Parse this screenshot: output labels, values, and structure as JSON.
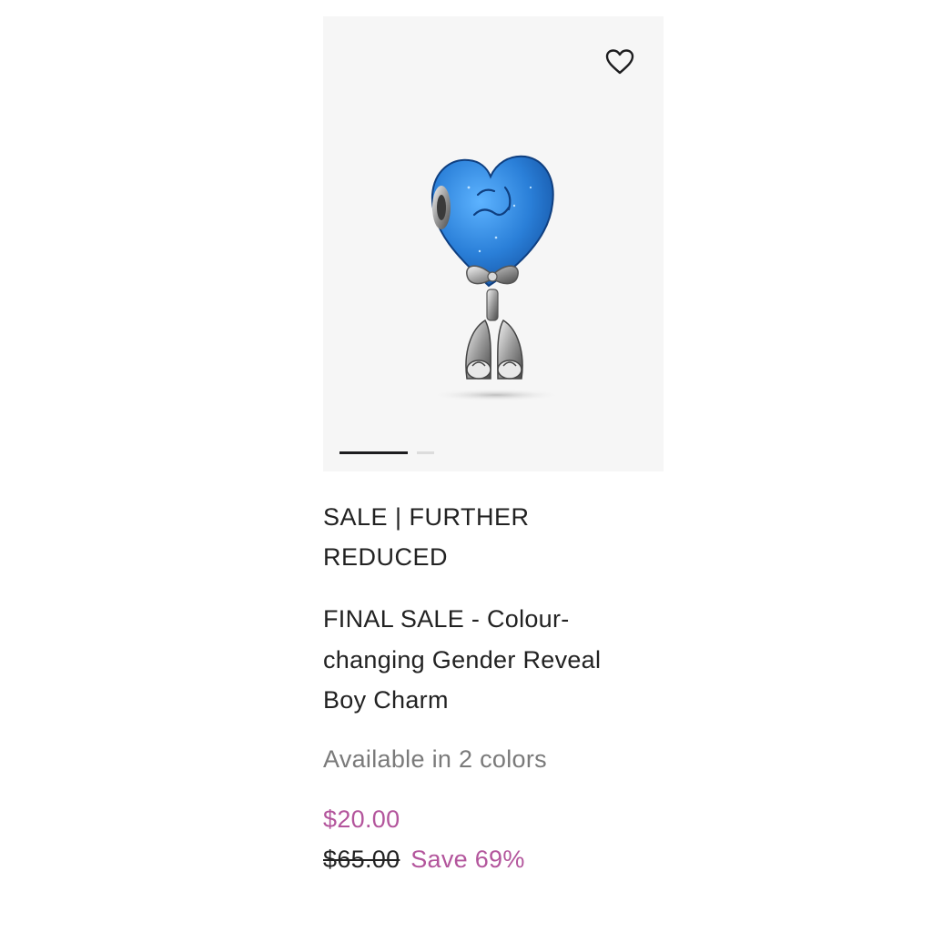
{
  "product": {
    "badge_line1": "SALE | FURTHER",
    "badge_line2": "REDUCED",
    "title_line1": "FINAL SALE - Colour-",
    "title_line2": "changing Gender Reveal",
    "title_line3": "Boy Charm",
    "availability": "Available in 2 colors",
    "sale_price": "$20.00",
    "original_price": "$65.00",
    "savings": "Save 69%",
    "image_slides": 2,
    "active_slide": 1
  },
  "icons": {
    "wishlist": "heart-outline-icon"
  },
  "colors": {
    "sale": "#b3559c",
    "text": "#222222",
    "muted": "#7a7a7a",
    "image_bg": "#f6f6f6",
    "charm_blue": "#2f7fd6"
  }
}
